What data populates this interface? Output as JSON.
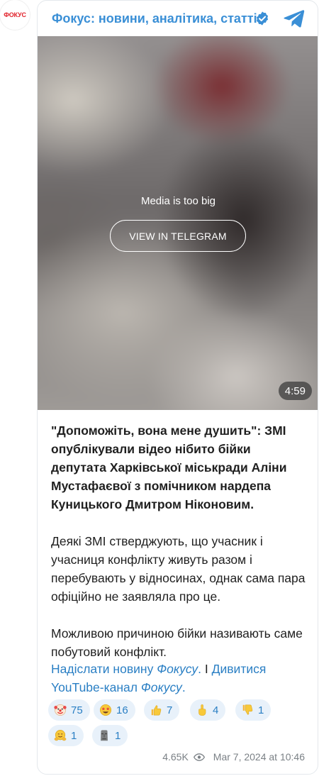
{
  "avatar": {
    "text": "ФОКУС",
    "color": "#e1222b"
  },
  "header": {
    "channel_name": "Фокус: новини, аналітика, статті",
    "verified_icon": "verified-badge-icon",
    "telegram_icon": "telegram-plane-icon"
  },
  "media": {
    "message": "Media is too big",
    "button_label": "VIEW IN TELEGRAM",
    "duration": "4:59"
  },
  "post": {
    "headline": "\"Допоможіть, вона мене душить\": ЗМІ опублікували відео нібито бійки депутата Харківської міськради Аліни Мустафаєвої з помічником нардепа Куницького Дмитром Ніконовим.",
    "paragraph_1": "Деякі ЗМІ стверджують, що учасник і учасниця конфлікту живуть разом і перебувають у відносинах, однак сама пара офіційно не заявляла про це.",
    "paragraph_2": "Можливою причиною бійки називають саме побутовий конфлікт."
  },
  "links": {
    "submit_prefix": "Надіслати новину ",
    "submit_italic": "Фокусу",
    "submit_suffix": ".",
    "separator": " І ",
    "youtube_prefix": "Дивитися YouTube-канал ",
    "youtube_italic": "Фокусу",
    "youtube_suffix": "."
  },
  "reactions": [
    {
      "icon": "clown-face-icon",
      "count": "75"
    },
    {
      "icon": "star-struck-icon",
      "count": "16"
    },
    {
      "icon": "thumbs-up-icon",
      "count": "7"
    },
    {
      "icon": "middle-finger-icon",
      "count": "4"
    },
    {
      "icon": "thumbs-down-icon",
      "count": "1"
    },
    {
      "icon": "hugging-face-icon",
      "count": "1"
    },
    {
      "icon": "moai-icon",
      "count": "1"
    }
  ],
  "footer": {
    "views": "4.65K",
    "views_icon": "eye-icon",
    "date": "Mar 7, 2024 at 10:46"
  },
  "colors": {
    "accent": "#3a8fd6",
    "link": "#2a7fc4",
    "reaction_bg": "#e8f1fa",
    "brand_red": "#e1222b"
  }
}
